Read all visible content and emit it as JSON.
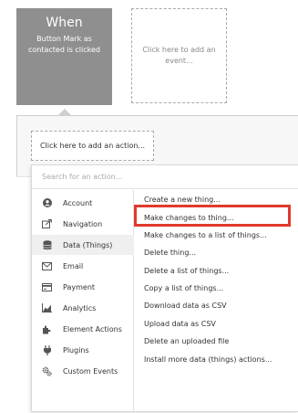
{
  "event": {
    "title": "When",
    "subtitle": "Button Mark as contacted is clicked",
    "add_event_label": "Click here to add an event..."
  },
  "workflow": {
    "add_action_label": "Click here to add an action..."
  },
  "menu": {
    "search_placeholder": "Search for an action...",
    "categories": [
      {
        "label": "Account",
        "icon": "account-icon"
      },
      {
        "label": "Navigation",
        "icon": "navigation-icon"
      },
      {
        "label": "Data (Things)",
        "icon": "database-icon",
        "selected": true
      },
      {
        "label": "Email",
        "icon": "email-icon"
      },
      {
        "label": "Payment",
        "icon": "payment-icon"
      },
      {
        "label": "Analytics",
        "icon": "analytics-icon"
      },
      {
        "label": "Element Actions",
        "icon": "element-actions-icon"
      },
      {
        "label": "Plugins",
        "icon": "plugins-icon"
      },
      {
        "label": "Custom Events",
        "icon": "custom-events-icon"
      }
    ],
    "actions": [
      "Create a new thing...",
      "Make changes to thing...",
      "Make changes to a list of things...",
      "Delete thing...",
      "Delete a list of things...",
      "Copy a list of things...",
      "Download data as CSV",
      "Upload data as CSV",
      "Delete an uploaded file",
      "Install more data (things) actions..."
    ],
    "highlighted_action_index": 1
  },
  "colors": {
    "when_card": "#8f8f8f",
    "highlight": "#e03a2b",
    "selected_category": "#efefef"
  }
}
